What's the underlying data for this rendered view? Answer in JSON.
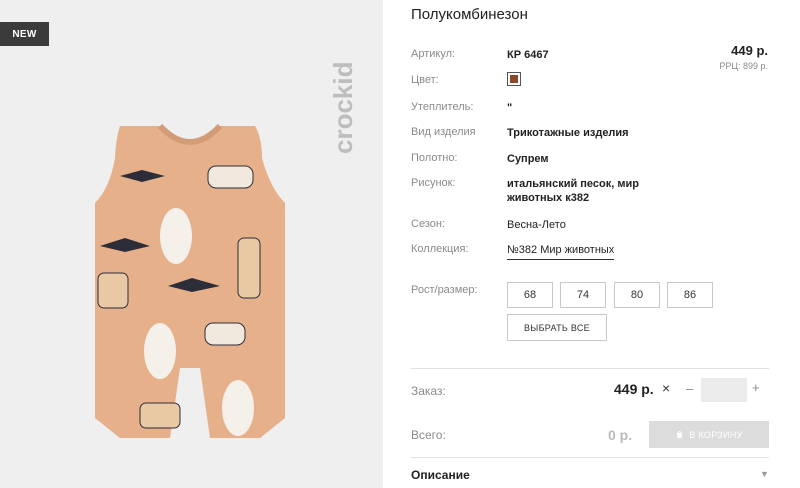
{
  "badge": "NEW",
  "brand": "crockid",
  "title": "Полукомбинезон",
  "price": {
    "main": "449 р.",
    "rrp": "РРЦ: 899 р."
  },
  "specs": {
    "article_label": "Артикул:",
    "article_value": "КР 6467",
    "color_label": "Цвет:",
    "color_hex": "#8a4a2a",
    "insulation_label": "Утеплитель:",
    "insulation_value": "\"",
    "type_label": "Вид изделия",
    "type_value": "Трикотажные изделия",
    "fabric_label": "Полотно:",
    "fabric_value": "Супрем",
    "print_label": "Рисунок:",
    "print_value": "итальянский песок, мир животных к382",
    "season_label": "Сезон:",
    "season_value": "Весна-Лето",
    "collection_label": "Коллекция:",
    "collection_value": "№382 Мир животных"
  },
  "sizes": {
    "label": "Рост/размер:",
    "options": [
      "68",
      "74",
      "80",
      "86"
    ],
    "select_all": "ВЫБРАТЬ ВСЕ"
  },
  "order": {
    "label": "Заказ:",
    "price": "449 р.",
    "times": "×",
    "minus": "–",
    "plus": "+",
    "qty": ""
  },
  "total": {
    "label": "Всего:",
    "value": "0 р.",
    "cart_button": "В КОРЗИНУ"
  },
  "description": {
    "label": "Описание",
    "arrow": "▼"
  }
}
